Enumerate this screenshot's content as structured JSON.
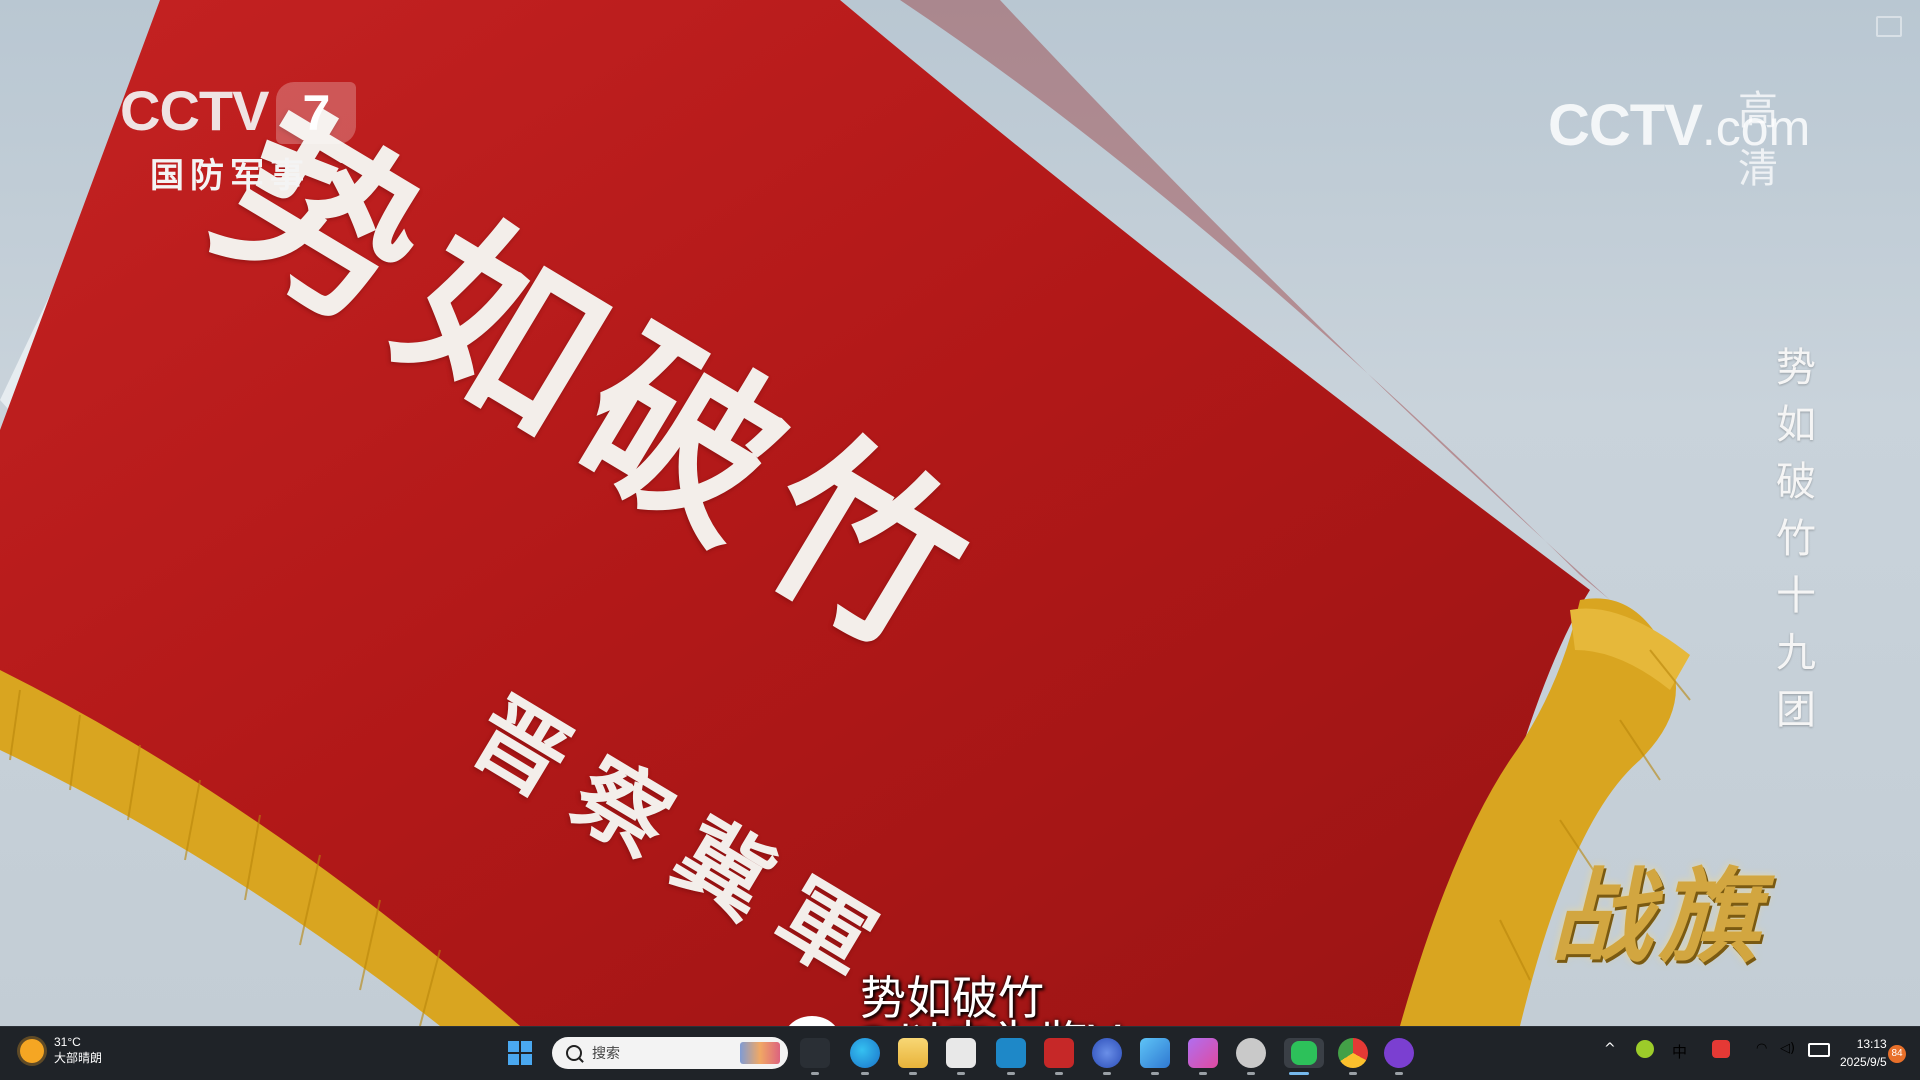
{
  "video": {
    "channel_logo": {
      "brand": "CCTV",
      "number": "7",
      "subtitle": "国防军事"
    },
    "site_logo": {
      "brand": "CCTV",
      "suffix": ".com",
      "quality": "高清"
    },
    "flag_title": "势如破竹",
    "flag_unit": "晋察冀軍",
    "vertical_caption": "势如破竹十九团",
    "program_logo": "战旗",
    "subtitle": "势如破竹",
    "watermark": "@以史为鉴V",
    "colors": {
      "flag_red": "#b81c1c",
      "fringe_gold": "#d9a520",
      "sky": "#c3cdd5"
    }
  },
  "taskbar": {
    "weather": {
      "temperature": "31°C",
      "condition": "大部晴朗"
    },
    "search_placeholder": "搜索",
    "apps": [
      "start-icon",
      "search-box",
      "task-view-icon",
      "edge-icon",
      "file-explorer-icon",
      "store-icon",
      "terminal-icon",
      "app-icon",
      "browser-icon",
      "photos-icon",
      "design-app-icon",
      "cat-app-icon",
      "wechat-icon",
      "chrome-icon",
      "vpn-app-icon"
    ],
    "tray": {
      "ime_label": "中",
      "time": "13:13",
      "date": "2025/9/5",
      "notification_count": "84"
    }
  }
}
